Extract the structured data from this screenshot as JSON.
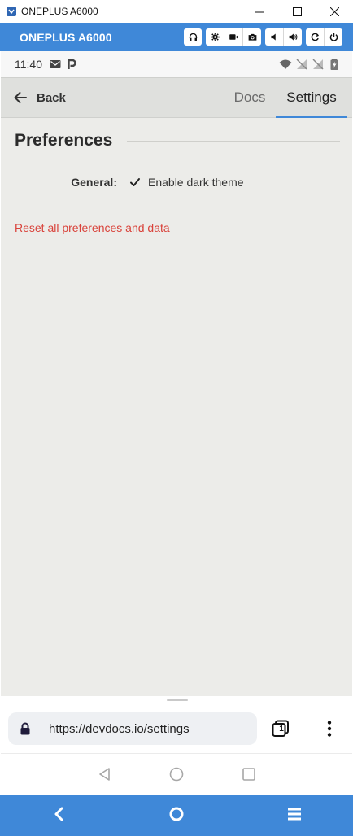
{
  "window": {
    "title": "ONEPLUS A6000"
  },
  "emulator": {
    "device_name": "ONEPLUS A6000",
    "accent": "#3f88d8"
  },
  "status_bar": {
    "time": "11:40"
  },
  "header": {
    "back_label": "Back",
    "tabs": [
      {
        "label": "Docs",
        "active": false
      },
      {
        "label": "Settings",
        "active": true
      }
    ]
  },
  "preferences": {
    "heading": "Preferences",
    "general_label": "General:",
    "dark_theme_label": "Enable dark theme",
    "dark_theme_checked": true,
    "reset_label": "Reset all preferences and data",
    "reset_color": "#d9433b"
  },
  "browser": {
    "url": "https://devdocs.io/settings",
    "tab_count": "1"
  }
}
